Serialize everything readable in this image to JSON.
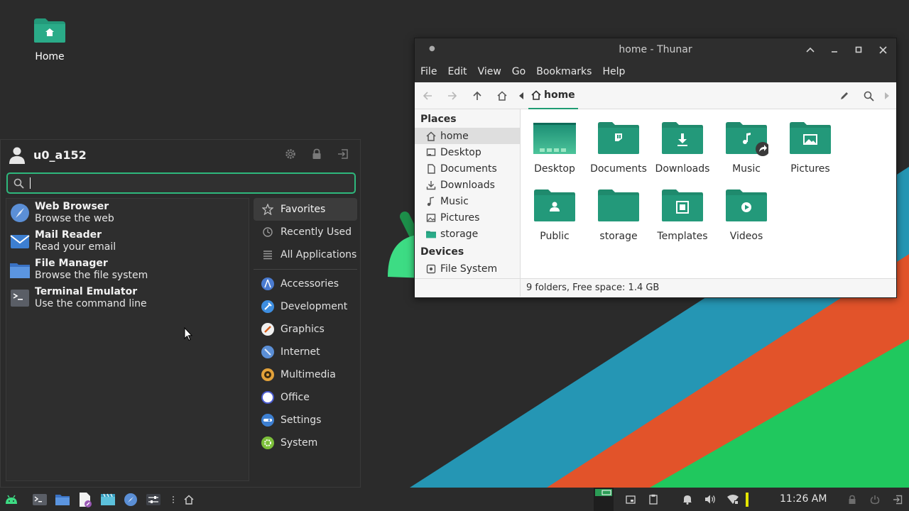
{
  "colors": {
    "accent": "#1f9c73",
    "folder": "#23997a",
    "stripe_blue": "#2596b4",
    "stripe_orange": "#e2532a",
    "stripe_green": "#20c85e",
    "panel": "#2b2b2b"
  },
  "desktop": {
    "home_icon_label": "Home",
    "home_icon": "home-folder-icon"
  },
  "thunar": {
    "title": "home - Thunar",
    "menu": [
      "File",
      "Edit",
      "View",
      "Go",
      "Bookmarks",
      "Help"
    ],
    "path_label": "home",
    "places_header": "Places",
    "places": [
      {
        "label": "home",
        "icon": "home-icon"
      },
      {
        "label": "Desktop",
        "icon": "desktop-icon"
      },
      {
        "label": "Documents",
        "icon": "document-icon"
      },
      {
        "label": "Downloads",
        "icon": "download-icon"
      },
      {
        "label": "Music",
        "icon": "music-icon"
      },
      {
        "label": "Pictures",
        "icon": "picture-icon"
      },
      {
        "label": "storage",
        "icon": "storage-folder-icon"
      }
    ],
    "devices_header": "Devices",
    "devices": [
      {
        "label": "File System",
        "icon": "drive-icon"
      }
    ],
    "folders": [
      "Desktop",
      "Documents",
      "Downloads",
      "Music",
      "Pictures",
      "Public",
      "storage",
      "Templates",
      "Videos"
    ],
    "status": "9 folders, Free space: 1.4 GB"
  },
  "whisker": {
    "username": "u0_a152",
    "search_value": "",
    "apps": [
      {
        "name": "Web Browser",
        "desc": "Browse the web",
        "icon": "web-browser-icon"
      },
      {
        "name": "Mail Reader",
        "desc": "Read your email",
        "icon": "mail-icon"
      },
      {
        "name": "File Manager",
        "desc": "Browse the file system",
        "icon": "file-manager-icon"
      },
      {
        "name": "Terminal Emulator",
        "desc": "Use the command line",
        "icon": "terminal-icon"
      }
    ],
    "top_categories": [
      "Favorites",
      "Recently Used",
      "All Applications"
    ],
    "categories": [
      "Accessories",
      "Development",
      "Graphics",
      "Internet",
      "Multimedia",
      "Office",
      "Settings",
      "System"
    ]
  },
  "panel": {
    "clock": "11:26 AM"
  }
}
